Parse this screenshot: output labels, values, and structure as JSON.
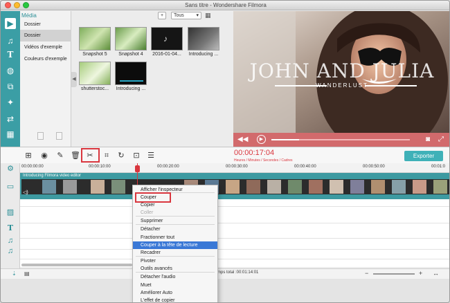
{
  "window": {
    "title": "Sans titre - Wondershare Filmora"
  },
  "colors": {
    "accent": "#3fb1b8",
    "highlight_red": "#d9363e",
    "preview_controls": "#d26a6c",
    "menu_selected": "#3a78d6"
  },
  "sidebar_icons": [
    "media-icon",
    "music-icon",
    "text-icon",
    "filter-icon",
    "overlay-icon",
    "elements-icon",
    "transition-icon",
    "split-screen-icon"
  ],
  "categories": {
    "header": "Média",
    "items": [
      "Dossier",
      "Dossier",
      "Vidéos d'exemple",
      "Couleurs d'exemple"
    ]
  },
  "media": {
    "add_label": "+",
    "filter_value": "Tous",
    "thumbs": [
      "Snapshot 5",
      "Snapshot 4",
      "2016-01-04...",
      "Introducing ...",
      "shutterstoc...",
      "Introducing ..."
    ]
  },
  "preview": {
    "title_text": "JOHN AND JULIA",
    "subtitle_text": "WANDERLUST",
    "progress": 0.2
  },
  "toolbar": {
    "tools": [
      "add-track-icon",
      "record-icon",
      "edit-icon",
      "delete-icon",
      "split-icon",
      "crop-icon",
      "rotate-icon",
      "voiceover-icon",
      "settings-icon"
    ],
    "timecode": "00:00:17:04",
    "timecode_caption": "Heures / Minutes / Secondes / Cadres",
    "export_label": "Exporter"
  },
  "ruler": {
    "ticks": [
      "00:00:00:00",
      "00:00:10:00",
      "00:00:20:00",
      "00:00:30:00",
      "00:00:40:00",
      "00:00:50:00",
      "00:01:0"
    ]
  },
  "timeline": {
    "clip_title": "Introducing Filmora video editor",
    "status_text": "mps total :00:01:14:01"
  },
  "context_menu": {
    "items": [
      {
        "label": "Afficher l'inspecteur",
        "state": "normal"
      },
      {
        "label": "Couper",
        "state": "boxed"
      },
      {
        "label": "Copier",
        "state": "normal"
      },
      {
        "label": "Coller",
        "state": "disabled"
      },
      {
        "label": "Supprimer",
        "state": "normal"
      },
      {
        "label": "Détacher",
        "state": "normal"
      },
      {
        "label": "Fractionner tout",
        "state": "normal"
      },
      {
        "label": "Couper à la tête de lecture",
        "state": "selected"
      },
      {
        "label": "Recadrer",
        "state": "normal"
      },
      {
        "label": "Pivoter",
        "state": "normal"
      },
      {
        "label": "Outils avancés",
        "state": "normal"
      },
      {
        "label": "Détacher l'audio",
        "state": "normal"
      },
      {
        "label": "Muet",
        "state": "normal"
      },
      {
        "label": "Améliorer Auto",
        "state": "normal"
      },
      {
        "label": "L'effet de copier",
        "state": "normal"
      }
    ]
  }
}
